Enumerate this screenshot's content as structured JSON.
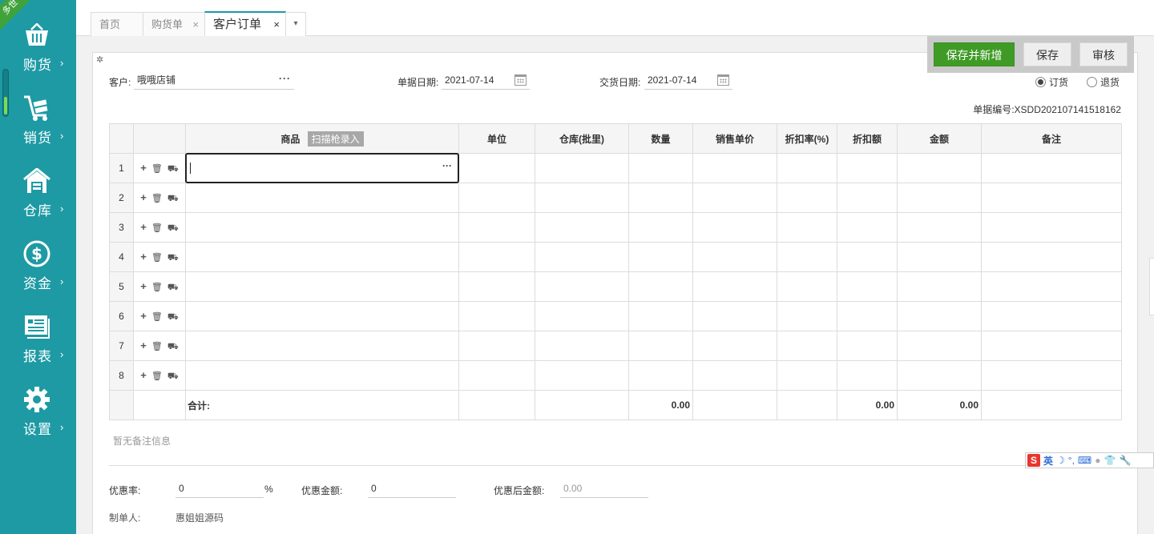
{
  "sidebar": {
    "ribbon": "多世",
    "items": [
      {
        "label": "购货",
        "icon": "basket-icon"
      },
      {
        "label": "销货",
        "icon": "cart-icon"
      },
      {
        "label": "仓库",
        "icon": "warehouse-icon"
      },
      {
        "label": "资金",
        "icon": "dollar-icon"
      },
      {
        "label": "报表",
        "icon": "report-icon"
      },
      {
        "label": "设置",
        "icon": "gear-icon"
      }
    ],
    "arrow": "›"
  },
  "tabs": [
    {
      "label": "首页"
    },
    {
      "label": "购货单",
      "close": "×"
    },
    {
      "label": "客户订单",
      "close": "×"
    }
  ],
  "tab_more": "▾",
  "actions": {
    "save_new": "保存并新增",
    "save": "保存",
    "audit": "审核"
  },
  "form": {
    "customer_label": "客户:",
    "customer_value": "哦哦店铺",
    "bill_date_label": "单据日期:",
    "bill_date_value": "2021-07-14",
    "delivery_date_label": "交货日期:",
    "delivery_date_value": "2021-07-14",
    "order_type": {
      "order": "订货",
      "return": "退货",
      "selected": "订货"
    },
    "doc_no": "单据编号:XSDD202107141518162",
    "dots": "···"
  },
  "grid": {
    "headers": [
      "商品",
      "单位",
      "仓库(批里)",
      "数量",
      "销售单价",
      "折扣率(%)",
      "折扣额",
      "金额",
      "备注"
    ],
    "scan_button": "扫描枪录入",
    "rows": [
      "1",
      "2",
      "3",
      "4",
      "5",
      "6",
      "7",
      "8"
    ],
    "row_ops": {
      "add": "+",
      "delete": "🗑",
      "cart": "⛟"
    },
    "total_label": "合计:",
    "totals": {
      "quantity": "0.00",
      "discount_amount": "0.00",
      "amount": "0.00"
    }
  },
  "note_empty": "暂无备注信息",
  "footer": {
    "discount_rate_label": "优惠率:",
    "discount_rate_value": "0",
    "percent": "%",
    "discount_amount_label": "优惠金额:",
    "discount_amount_value": "0",
    "after_discount_label": "优惠后金额:",
    "after_discount_value": "0.00",
    "maker_label": "制单人:",
    "maker_value": "惠姐姐源码"
  },
  "ime": {
    "logo": "S",
    "lang": "英"
  },
  "colors": {
    "sidebar": "#1e9aa4",
    "primary": "#3f9b26",
    "ribbon": "#3fa33a"
  }
}
